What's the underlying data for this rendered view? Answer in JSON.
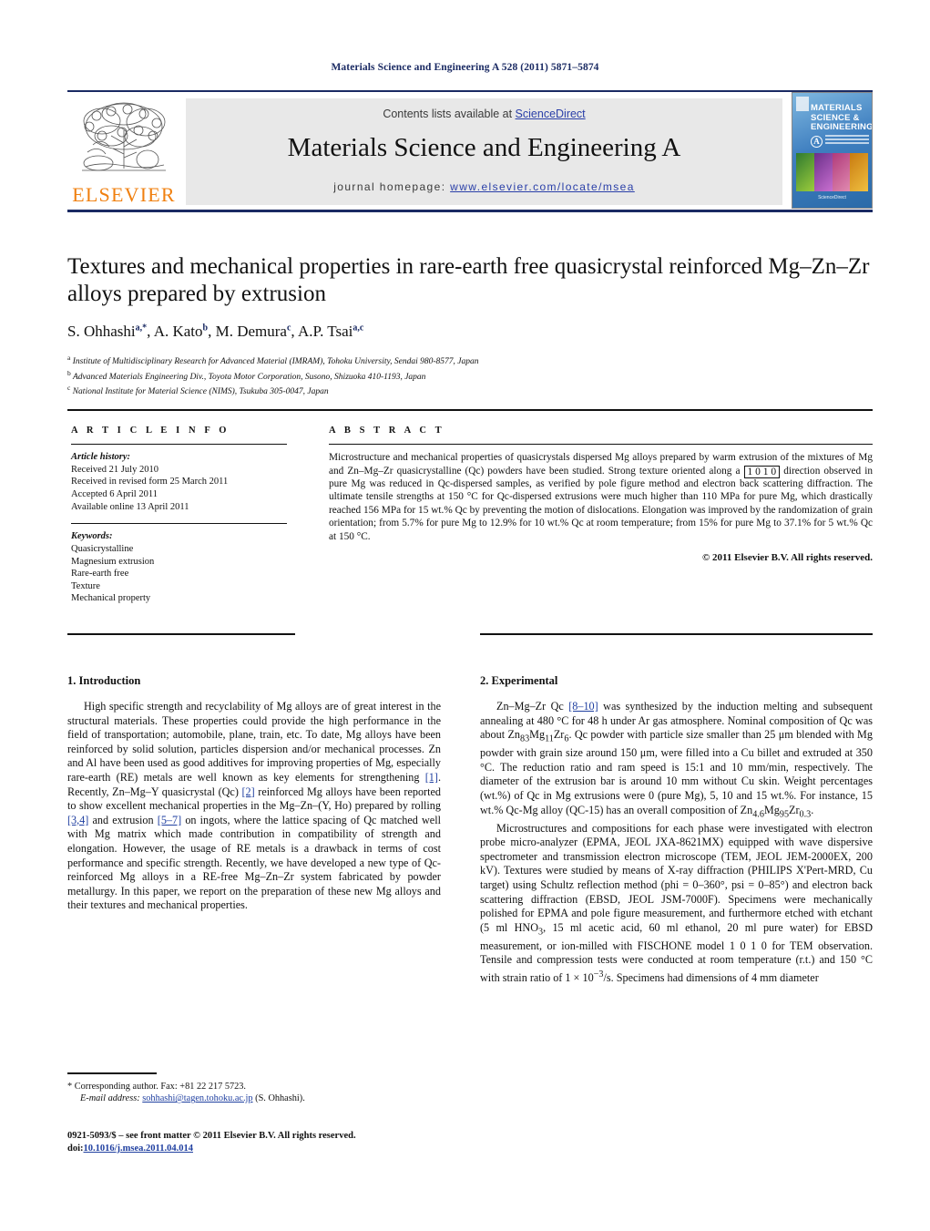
{
  "running_head": "Materials Science and Engineering A 528 (2011) 5871–5874",
  "masthead": {
    "contents_prefix": "Contents lists available at ",
    "sciencedirect": "ScienceDirect",
    "journal_title": "Materials Science and Engineering A",
    "homepage_prefix": "journal homepage:",
    "homepage_url": "www.elsevier.com/locate/msea",
    "publisher": "ELSEVIER",
    "cover": {
      "line1": "MATERIALS",
      "line2": "SCIENCE &",
      "line3": "ENGINEERING",
      "section_mark": "A",
      "footer": "ScienceDirect"
    },
    "accent_blue": "#1a2a63",
    "link_blue": "#2a3fa8",
    "elsevier_orange": "#f08010"
  },
  "article": {
    "title": "Textures and mechanical properties in rare-earth free quasicrystal reinforced Mg–Zn–Zr alloys prepared by extrusion",
    "authors": [
      {
        "name": "S. Ohhashi",
        "marks": "a,*"
      },
      {
        "name": "A. Kato",
        "marks": "b"
      },
      {
        "name": "M. Demura",
        "marks": "c"
      },
      {
        "name": "A.P. Tsai",
        "marks": "a,c"
      }
    ],
    "affiliations": [
      {
        "mark": "a",
        "text": "Institute of Multidisciplinary Research for Advanced Material (IMRAM), Tohoku University, Sendai 980-8577, Japan"
      },
      {
        "mark": "b",
        "text": "Advanced Materials Engineering Div., Toyota Motor Corporation, Susono, Shizuoka 410-1193, Japan"
      },
      {
        "mark": "c",
        "text": "National Institute for Material Science (NIMS), Tsukuba 305-0047, Japan"
      }
    ]
  },
  "article_info": {
    "label": "A R T I C L E   I N F O",
    "history_label": "Article history:",
    "history": [
      "Received 21 July 2010",
      "Received in revised form 25 March 2011",
      "Accepted 6 April 2011",
      "Available online 13 April 2011"
    ],
    "keywords_label": "Keywords:",
    "keywords": [
      "Quasicrystalline",
      "Magnesium extrusion",
      "Rare-earth free",
      "Texture",
      "Mechanical property"
    ]
  },
  "abstract": {
    "label": "A B S T R A C T",
    "part1": "Microstructure and mechanical properties of quasicrystals dispersed Mg alloys prepared by warm extrusion of the mixtures of Mg and Zn–Mg–Zr quasicrystalline (Qc) powders have been studied. Strong texture oriented along a ",
    "miller_pre": "1 0 ",
    "miller_bar": "1",
    "miller_post": " 0",
    "part2": " direction observed in pure Mg was reduced in Qc-dispersed samples, as verified by pole figure method and electron back scattering diffraction. The ultimate tensile strengths at 150 °C for Qc-dispersed extrusions were much higher than 110 MPa for pure Mg, which drastically reached 156 MPa for 15 wt.% Qc by preventing the motion of dislocations. Elongation was improved by the randomization of grain orientation; from 5.7% for pure Mg to 12.9% for 10 wt.% Qc at room temperature; from 15% for pure Mg to 37.1% for 5 wt.% Qc at 150 °C.",
    "copyright": "© 2011 Elsevier B.V. All rights reserved."
  },
  "sections": {
    "introduction": {
      "heading": "1.  Introduction",
      "p1_a": "High specific strength and recyclability of Mg alloys are of great interest in the structural materials. These properties could provide the high performance in the field of transportation; automobile, plane, train, etc. To date, Mg alloys have been reinforced by solid solution, particles dispersion and/or mechanical processes. Zn and Al have been used as good additives for improving properties of Mg, especially rare-earth (RE) metals are well known as key elements for strengthening ",
      "c1": "[1]",
      "p1_b": ". Recently, Zn–Mg–Y quasicrystal (Qc) ",
      "c2": "[2]",
      "p1_c": " reinforced Mg alloys have been reported to show excellent mechanical properties in the Mg–Zn–(Y, Ho) prepared by rolling ",
      "c3": "[3,4]",
      "p1_d": " and extrusion ",
      "c4": "[5–7]",
      "p1_e": " on ingots, where the lattice spacing of Qc matched well with Mg matrix which made contribution in compatibility of strength and elongation. However, the usage of RE metals is a drawback in terms of cost performance and specific strength. Recently, we have developed a new type of Qc-reinforced Mg alloys in a RE-free Mg–Zn–Zr system fabricated by powder metallurgy. In this paper, we report on the preparation of these new Mg alloys and their textures and mechanical properties."
    },
    "experimental": {
      "heading": "2.  Experimental",
      "p1_a": "Zn–Mg–Zr Qc ",
      "c1": "[8–10]",
      "p1_b": " was synthesized by the induction melting and subsequent annealing at 480 °C for 48 h under Ar gas atmosphere. Nominal composition of Qc was about Zn",
      "sub1": "83",
      "p1_c": "Mg",
      "sub2": "11",
      "p1_d": "Zr",
      "sub3": "6",
      "p1_e": ". Qc powder with particle size smaller than 25 μm blended with Mg powder with grain size around 150 μm, were filled into a Cu billet and extruded at 350 °C. The reduction ratio and ram speed is 15:1 and 10 mm/min, respectively. The diameter of the extrusion bar is around 10 mm without Cu skin. Weight percentages (wt.%) of Qc in Mg extrusions were 0 (pure Mg), 5, 10 and 15 wt.%. For instance, 15 wt.% Qc-Mg alloy (QC-15) has an overall composition of Zn",
      "sub4": "4.6",
      "p1_f": "Mg",
      "sub5": "95",
      "p1_g": "Zr",
      "sub6": "0.3",
      "p1_h": ".",
      "p2_a": "Microstructures and compositions for each phase were investigated with electron probe micro-analyzer (EPMA, JEOL JXA-8621MX) equipped with wave dispersive spectrometer and transmission electron microscope (TEM, JEOL JEM-2000EX, 200 kV). Textures were studied by means of X-ray diffraction (PHILIPS X'Pert-MRD, Cu target) using Schultz reflection method (phi = 0–360°, psi = 0–85°) and electron back scattering diffraction (EBSD, JEOL JSM-7000F). Specimens were mechanically polished for EPMA and pole figure measurement, and furthermore etched with etchant (5 ml HNO",
      "sub7": "3",
      "p2_b": ", 15 ml acetic acid, 60 ml ethanol, 20 ml pure water) for EBSD measurement, or ion-milled with FISCHONE model 1 0 1 0 for TEM observation. Tensile and compression tests were conducted at room temperature (r.t.) and 150 °C with strain ratio of 1 × 10",
      "sup1": "−3",
      "p2_c": "/s. Specimens had dimensions of 4 mm diameter"
    }
  },
  "footnotes": {
    "corresponding": "*  Corresponding author. Fax: +81 22 217 5723.",
    "email_label": "E-mail address:",
    "email": "sohhashi@tagen.tohoku.ac.jp",
    "email_suffix": "(S. Ohhashi).",
    "imprint_line1": "0921-5093/$ – see front matter © 2011 Elsevier B.V. All rights reserved.",
    "imprint_doi_label": "doi:",
    "imprint_doi": "10.1016/j.msea.2011.04.014"
  }
}
